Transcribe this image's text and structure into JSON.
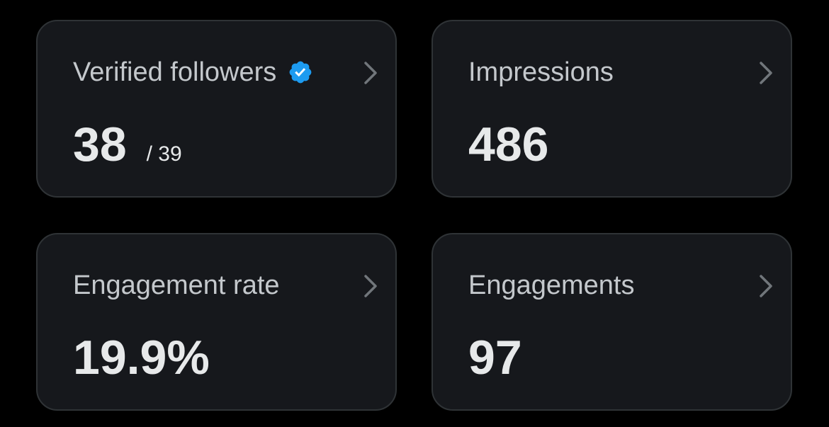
{
  "cards": [
    {
      "label": "Verified followers",
      "value": "38",
      "sub": "/ 39",
      "badge_icon": "verified-badge-icon",
      "chevron_icon": "chevron-right-icon"
    },
    {
      "label": "Impressions",
      "value": "486",
      "chevron_icon": "chevron-right-icon"
    },
    {
      "label": "Engagement rate",
      "value": "19.9%",
      "chevron_icon": "chevron-right-icon"
    },
    {
      "label": "Engagements",
      "value": "97",
      "chevron_icon": "chevron-right-icon"
    }
  ],
  "colors": {
    "background": "#000000",
    "card": "#16181c",
    "border": "#2f3336",
    "label": "#c4c8cc",
    "value": "#e7e9ea",
    "badge": "#1d9bf0",
    "chevron": "#71767b"
  }
}
